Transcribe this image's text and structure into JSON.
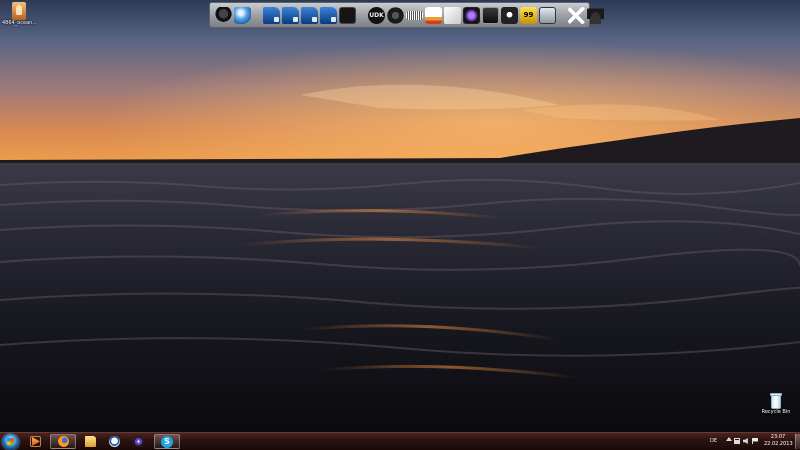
{
  "desktop": {
    "icons": [
      {
        "label": "4864_ocean...",
        "icon": "image-file-icon"
      },
      {
        "label": "Recycle Bin",
        "icon": "recycle-bin-icon"
      }
    ]
  },
  "dock": {
    "items": [
      {
        "icon": "top-hat-app-icon"
      },
      {
        "icon": "globe-icon"
      },
      {
        "icon": "drive-icon"
      },
      {
        "icon": "drive-doc-icon"
      },
      {
        "icon": "drive-music-icon"
      },
      {
        "icon": "drive-network-icon"
      },
      {
        "icon": "black-square-icon"
      },
      {
        "icon": "udk-icon",
        "text": "UDK"
      },
      {
        "icon": "steam-icon"
      },
      {
        "icon": "audio-wave-icon"
      },
      {
        "icon": "equalizer-icon"
      },
      {
        "icon": "cube-icon"
      },
      {
        "icon": "purple-orb-icon"
      },
      {
        "icon": "monitor-app-icon"
      },
      {
        "icon": "cat-app-icon"
      },
      {
        "icon": "gold-badge-icon",
        "text": "99"
      },
      {
        "icon": "screen-icon"
      },
      {
        "icon": "scissors-icon"
      },
      {
        "icon": "top-hat-icon"
      }
    ]
  },
  "taskbar": {
    "pinned": [
      {
        "name": "windows-media-player",
        "icon": "media-player-icon"
      },
      {
        "name": "firefox",
        "icon": "firefox-icon",
        "active": true
      },
      {
        "name": "windows-explorer",
        "icon": "folder-icon"
      },
      {
        "name": "kettle-app",
        "icon": "kettle-icon"
      },
      {
        "name": "eye-app",
        "icon": "eye-icon"
      },
      {
        "name": "skype",
        "icon": "skype-icon",
        "active": true,
        "text": "S"
      }
    ],
    "tray": {
      "language": "DE",
      "time": "23:07",
      "date": "22.02.2013"
    }
  }
}
